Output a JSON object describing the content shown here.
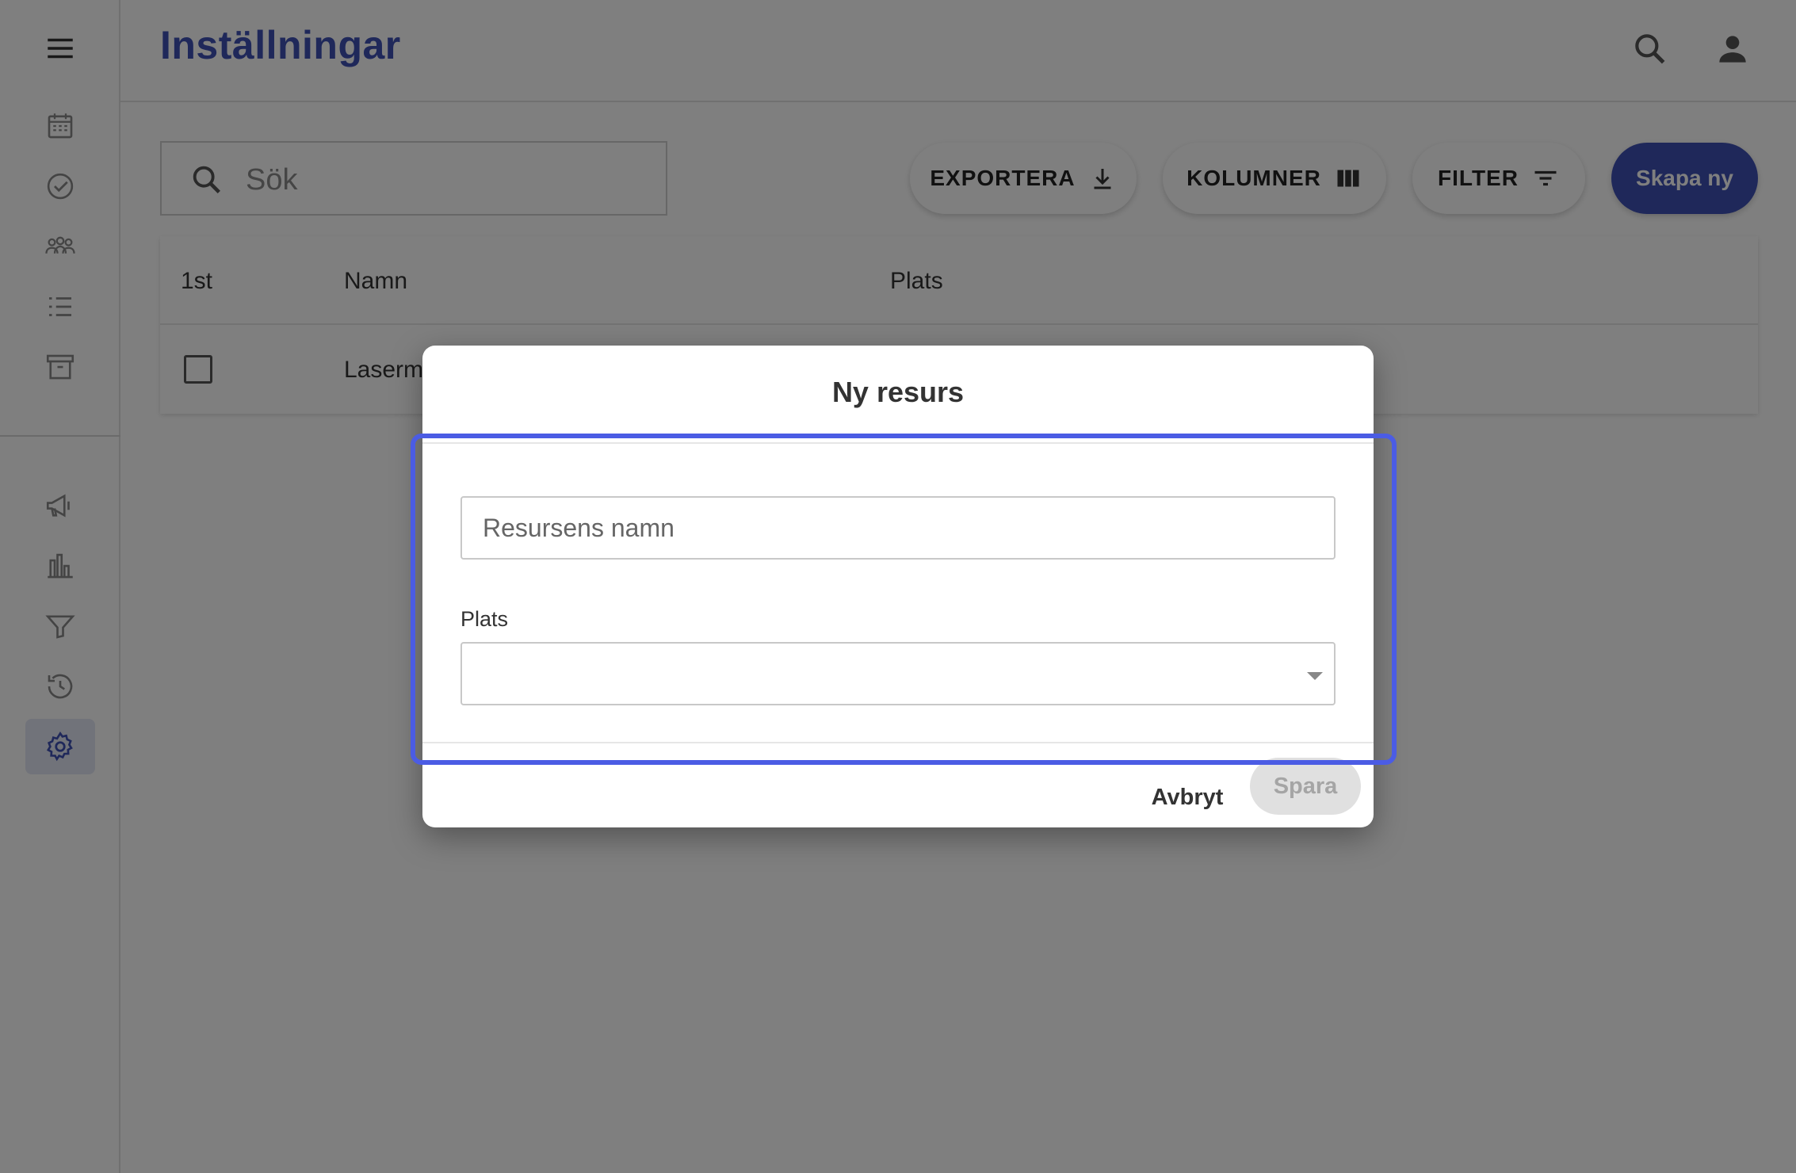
{
  "header": {
    "title": "Inställningar"
  },
  "colors": {
    "accent": "#3f51b5",
    "highlight": "#4b5ce4"
  },
  "sidebar": {
    "items": [
      {
        "icon": "calendar-icon"
      },
      {
        "icon": "check-circle-icon"
      },
      {
        "icon": "group-icon"
      },
      {
        "icon": "list-icon"
      },
      {
        "icon": "archive-icon"
      },
      {
        "icon": "megaphone-icon"
      },
      {
        "icon": "bar-chart-icon"
      },
      {
        "icon": "filter-icon"
      },
      {
        "icon": "history-icon"
      },
      {
        "icon": "gear-icon",
        "active": true
      }
    ]
  },
  "search": {
    "placeholder": "Sök"
  },
  "toolbar": {
    "export_label": "EXPORTERA",
    "columns_label": "KOLUMNER",
    "filter_label": "FILTER",
    "create_label": "Skapa ny"
  },
  "table": {
    "headers": [
      "1st",
      "Namn",
      "Plats"
    ],
    "rows": [
      {
        "name": "Laserm",
        "place": ""
      }
    ]
  },
  "dialog": {
    "title": "Ny resurs",
    "name_placeholder": "Resursens namn",
    "place_label": "Plats",
    "place_value": "",
    "cancel_label": "Avbryt",
    "save_label": "Spara"
  }
}
